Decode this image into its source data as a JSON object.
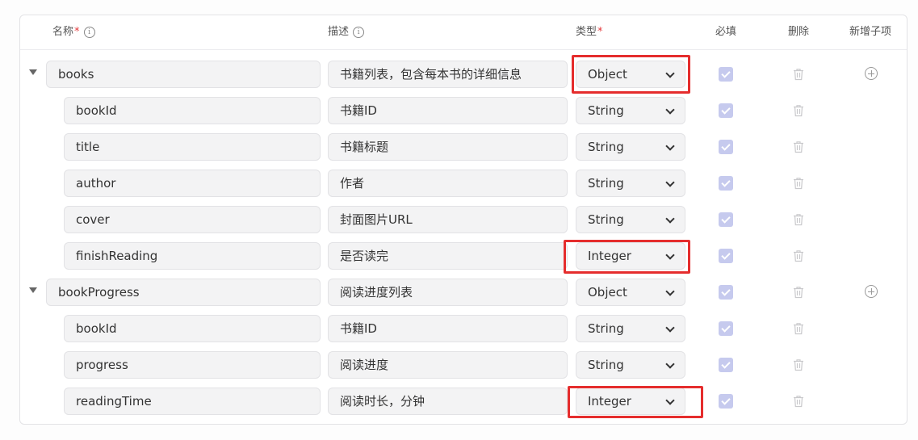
{
  "header": {
    "name": "名称",
    "description": "描述",
    "type": "类型",
    "required": "必填",
    "delete": "删除",
    "add_child": "新增子项",
    "required_mark": "*",
    "info_glyph": "i"
  },
  "rows": [
    {
      "name": "books",
      "description": "书籍列表，包含每本书的详细信息",
      "type": "Object",
      "required": true
    },
    {
      "name": "bookId",
      "description": "书籍ID",
      "type": "String",
      "required": true
    },
    {
      "name": "title",
      "description": "书籍标题",
      "type": "String",
      "required": true
    },
    {
      "name": "author",
      "description": "作者",
      "type": "String",
      "required": true
    },
    {
      "name": "cover",
      "description": "封面图片URL",
      "type": "String",
      "required": true
    },
    {
      "name": "finishReading",
      "description": "是否读完",
      "type": "Integer",
      "required": true
    },
    {
      "name": "bookProgress",
      "description": "阅读进度列表",
      "type": "Object",
      "required": true
    },
    {
      "name": "bookId",
      "description": "书籍ID",
      "type": "String",
      "required": true
    },
    {
      "name": "progress",
      "description": "阅读进度",
      "type": "String",
      "required": true
    },
    {
      "name": "readingTime",
      "description": "阅读时长，分钟",
      "type": "Integer",
      "required": true
    }
  ],
  "colors": {
    "highlight": "#e52d2d",
    "checkbox": "#c6caee",
    "field_bg": "#f3f3f4",
    "required_mark": "#e4393c"
  },
  "icons": {
    "expand": "caret-down-icon",
    "type_select": "chevron-down-icon",
    "delete": "trash-icon",
    "add_child": "plus-circle-icon",
    "info": "info-circle-icon"
  }
}
